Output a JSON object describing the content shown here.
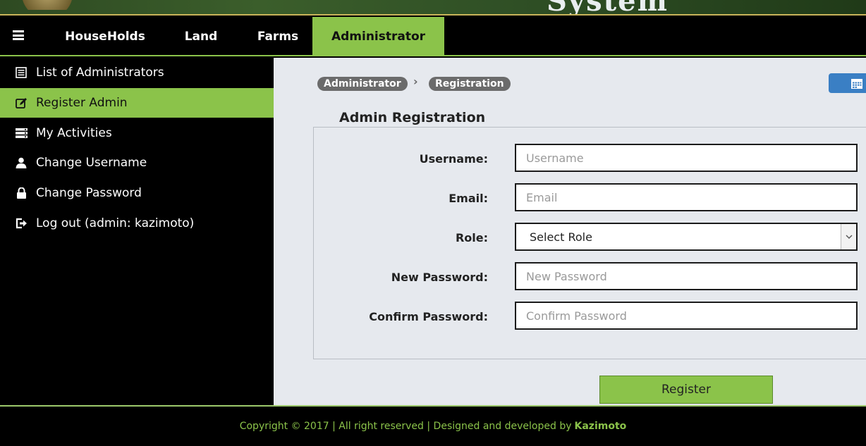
{
  "banner": {
    "system_text": "System"
  },
  "navbar": {
    "items": [
      {
        "label": "HouseHolds"
      },
      {
        "label": "Land"
      },
      {
        "label": "Farms"
      },
      {
        "label": "Administrator"
      }
    ],
    "active": "Administrator"
  },
  "sidebar": {
    "items": [
      {
        "label": "List of Administrators",
        "icon": "list-icon"
      },
      {
        "label": "Register Admin",
        "icon": "edit-icon"
      },
      {
        "label": "My Activities",
        "icon": "server-icon"
      },
      {
        "label": "Change Username",
        "icon": "user-icon"
      },
      {
        "label": "Change Password",
        "icon": "lock-icon"
      },
      {
        "label": "Log out (admin: kazimoto)",
        "icon": "logout-icon"
      }
    ],
    "active": "Register Admin"
  },
  "breadcrumb": {
    "items": [
      "Administrator",
      "Registration"
    ],
    "separator": "›"
  },
  "form": {
    "legend": "Admin Registration",
    "username": {
      "label": "Username:",
      "placeholder": "Username"
    },
    "email": {
      "label": "Email:",
      "placeholder": "Email"
    },
    "role": {
      "label": "Role:",
      "selected": "Select Role"
    },
    "new_password": {
      "label": "New Password:",
      "placeholder": "New Password"
    },
    "confirm_password": {
      "label": "Confirm Password:",
      "placeholder": "Confirm Password"
    },
    "submit_label": "Register"
  },
  "footer": {
    "text": "Copyright © 2017 | All right reserved | Designed and developed by",
    "brand": "Kazimoto"
  },
  "colors": {
    "accent": "#8bc34a",
    "navbar_bg": "#000000",
    "content_bg": "#e6e9ee",
    "breadcrumb_bg": "#6b6b6b",
    "calendar_button": "#3a7fc4"
  }
}
